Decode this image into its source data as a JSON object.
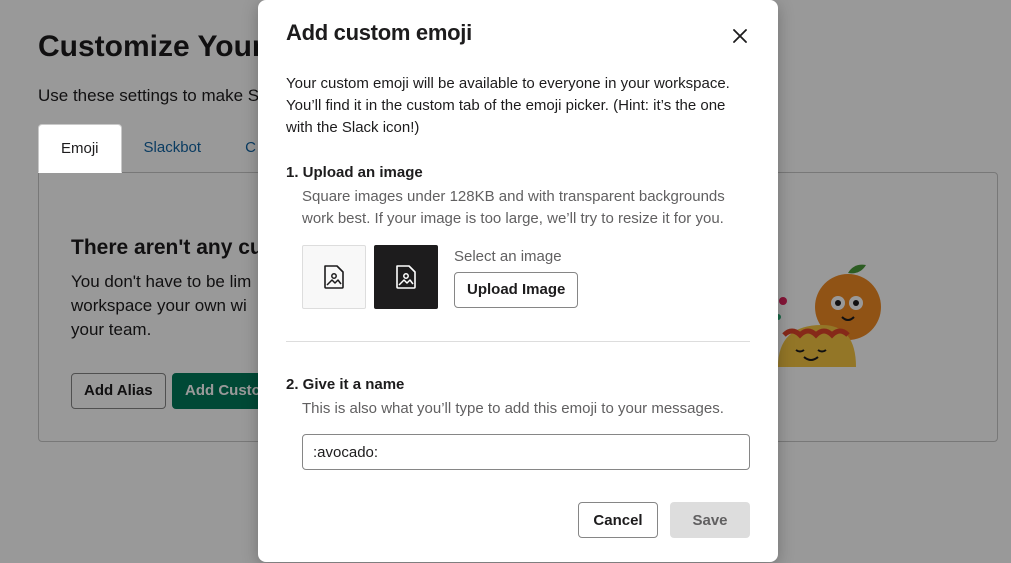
{
  "background": {
    "page_title": "Customize Your Workspace",
    "page_subtitle": "Use these settings to make Slack feel like home.",
    "tabs": [
      {
        "label": "Emoji"
      },
      {
        "label": "Slackbot"
      },
      {
        "label": "C"
      }
    ],
    "empty_title": "There aren't any cu",
    "empty_text": "You don't have to be lim workspace your own wi your team.",
    "add_alias_label": "Add Alias",
    "add_custom_label": "Add Custom Emoji"
  },
  "modal": {
    "title": "Add custom emoji",
    "intro": "Your custom emoji will be available to everyone in your workspace. You’ll find it in the custom tab of the emoji picker. (Hint: it’s the one with the Slack icon!)",
    "step1": {
      "title": "1. Upload an image",
      "description": "Square images under 128KB and with transparent backgrounds work best. If your image is too large, we’ll try to resize it for you.",
      "select_label": "Select an image",
      "upload_button": "Upload Image"
    },
    "step2": {
      "title": "2. Give it a name",
      "description": "This is also what you’ll type to add this emoji to your messages.",
      "input_value": ":avocado:"
    },
    "cancel_label": "Cancel",
    "save_label": "Save"
  },
  "colors": {
    "primary_green": "#007a5a",
    "link_blue": "#1264a3",
    "muted_text": "#616061",
    "overlay": "rgba(0,0,0,0.4)"
  },
  "icons": [
    "close-icon",
    "image-icon"
  ]
}
